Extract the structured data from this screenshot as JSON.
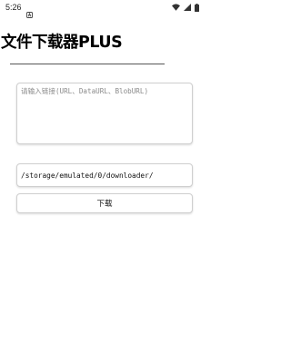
{
  "status_bar": {
    "time": "5:26",
    "icons": [
      "notification-a-icon",
      "wifi-icon",
      "cellular-signal-icon",
      "battery-icon"
    ]
  },
  "header": {
    "title": "文件下载器PLUS"
  },
  "form": {
    "url_placeholder": "请输入链接(URL、DataURL、BlobURL)",
    "url_value": "",
    "path_value": "/storage/emulated/0/downloader/",
    "download_label": "下载"
  },
  "colors": {
    "border": "#cfcfcf",
    "text": "#000000",
    "placeholder": "#8a8a8a",
    "divider": "#555555"
  }
}
